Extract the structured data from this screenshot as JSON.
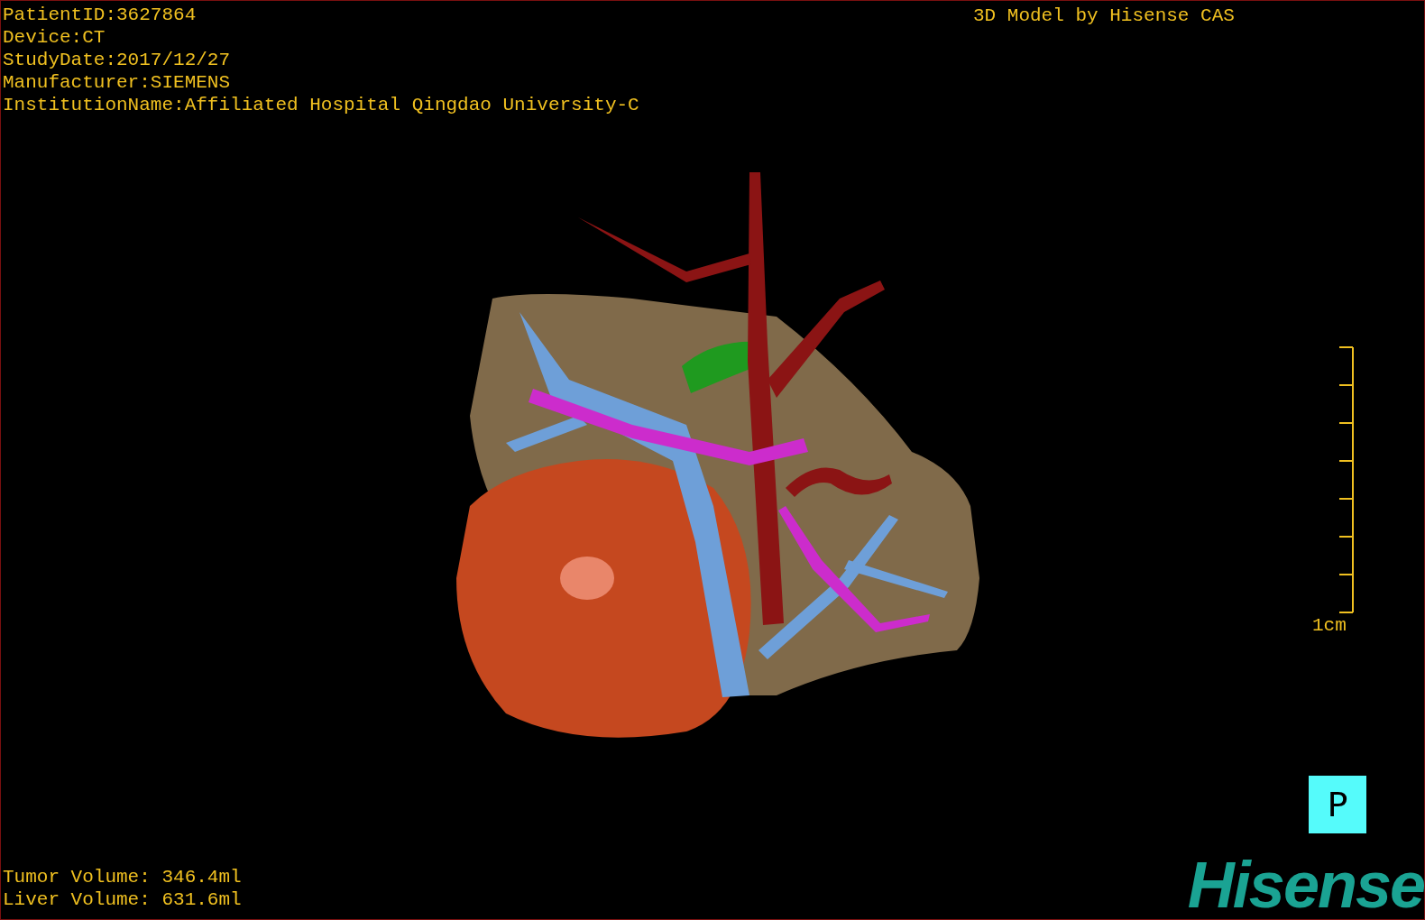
{
  "patient_info": [
    "PatientID:3627864",
    "Device:CT",
    "StudyDate:2017/12/27",
    "Manufacturer:SIEMENS",
    "InstitutionName:Affiliated Hospital Qingdao University-C"
  ],
  "model_title": "3D Model by Hisense CAS",
  "scale_bar": {
    "label": "1cm"
  },
  "orientation_marker": "P",
  "volumes": [
    "Tumor Volume: 346.4ml",
    "Liver Volume: 631.6ml"
  ],
  "logo": "Hisense"
}
